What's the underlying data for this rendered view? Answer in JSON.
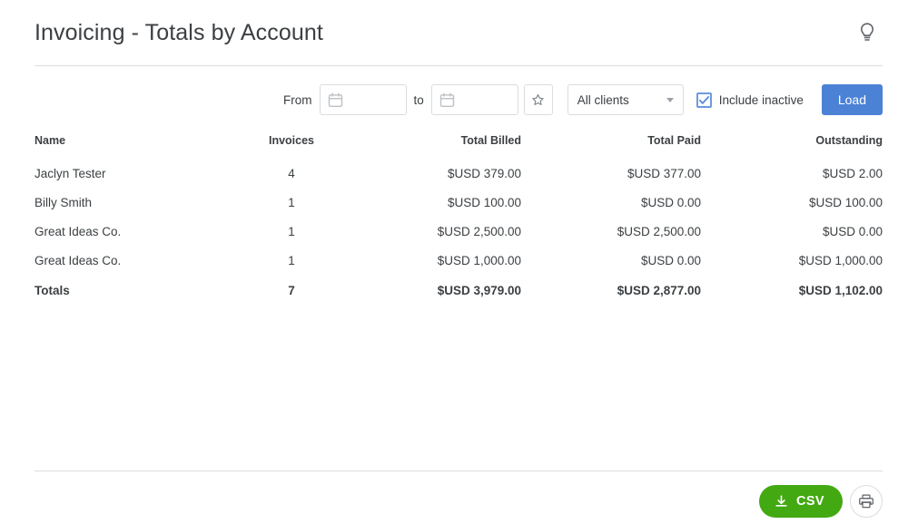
{
  "header": {
    "title": "Invoicing - Totals by Account",
    "help_icon": "lightbulb-icon"
  },
  "toolbar": {
    "from_label": "From",
    "to_label": "to",
    "from_value": "",
    "to_value": "",
    "from_placeholder": "",
    "to_placeholder": "",
    "date_icon": "calendar-icon",
    "favorite_icon": "star-icon",
    "client_select": {
      "selected": "All clients",
      "options": [
        "All clients"
      ]
    },
    "include_inactive": {
      "label": "Include inactive",
      "checked": true
    },
    "load_label": "Load",
    "load_color": "#4c82d6"
  },
  "table": {
    "columns": [
      "Name",
      "Invoices",
      "Total Billed",
      "Total Paid",
      "Outstanding"
    ],
    "rows": [
      {
        "name": "Jaclyn Tester",
        "invoices": "4",
        "billed": "$USD 379.00",
        "paid": "$USD 377.00",
        "outstanding": "$USD 2.00"
      },
      {
        "name": "Billy Smith",
        "invoices": "1",
        "billed": "$USD 100.00",
        "paid": "$USD 0.00",
        "outstanding": "$USD 100.00"
      },
      {
        "name": "Great Ideas Co.",
        "invoices": "1",
        "billed": "$USD 2,500.00",
        "paid": "$USD 2,500.00",
        "outstanding": "$USD 0.00"
      },
      {
        "name": "Great Ideas Co.",
        "invoices": "1",
        "billed": "$USD 1,000.00",
        "paid": "$USD 0.00",
        "outstanding": "$USD 1,000.00"
      }
    ],
    "totals": {
      "name": "Totals",
      "invoices": "7",
      "billed": "$USD 3,979.00",
      "paid": "$USD 2,877.00",
      "outstanding": "$USD 1,102.00"
    }
  },
  "footer": {
    "csv_label": "CSV",
    "csv_icon": "download-icon",
    "csv_color": "#43a912",
    "print_icon": "printer-icon"
  }
}
